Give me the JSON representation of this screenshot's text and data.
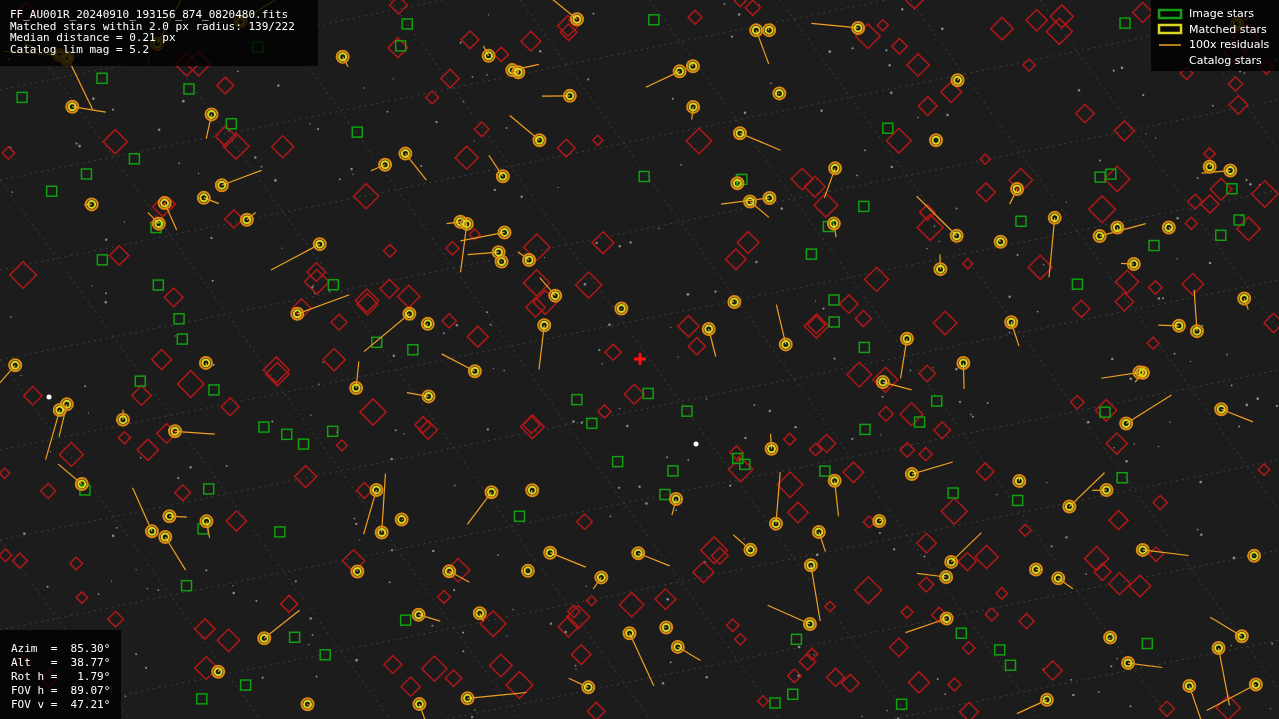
{
  "info_lines": [
    "FF_AU001R_20240910_193156_874_0820480.fits",
    "Matched stars within 2.0 px radius: 139/222",
    "Median distance = 0.21 px",
    "Catalog lim mag = 5.2"
  ],
  "legend": [
    {
      "kind": "image",
      "label": "Image stars"
    },
    {
      "kind": "matched",
      "label": "Matched stars"
    },
    {
      "kind": "residual",
      "label": "100x residuals"
    },
    {
      "kind": "catalog",
      "label": "Catalog stars"
    }
  ],
  "pointing_lines": [
    "Azim  =  85.30°",
    "Alt   =  38.77°",
    "Rot h =   1.79°",
    "FOV h =  89.07°",
    "FOV v =  47.21°"
  ]
}
